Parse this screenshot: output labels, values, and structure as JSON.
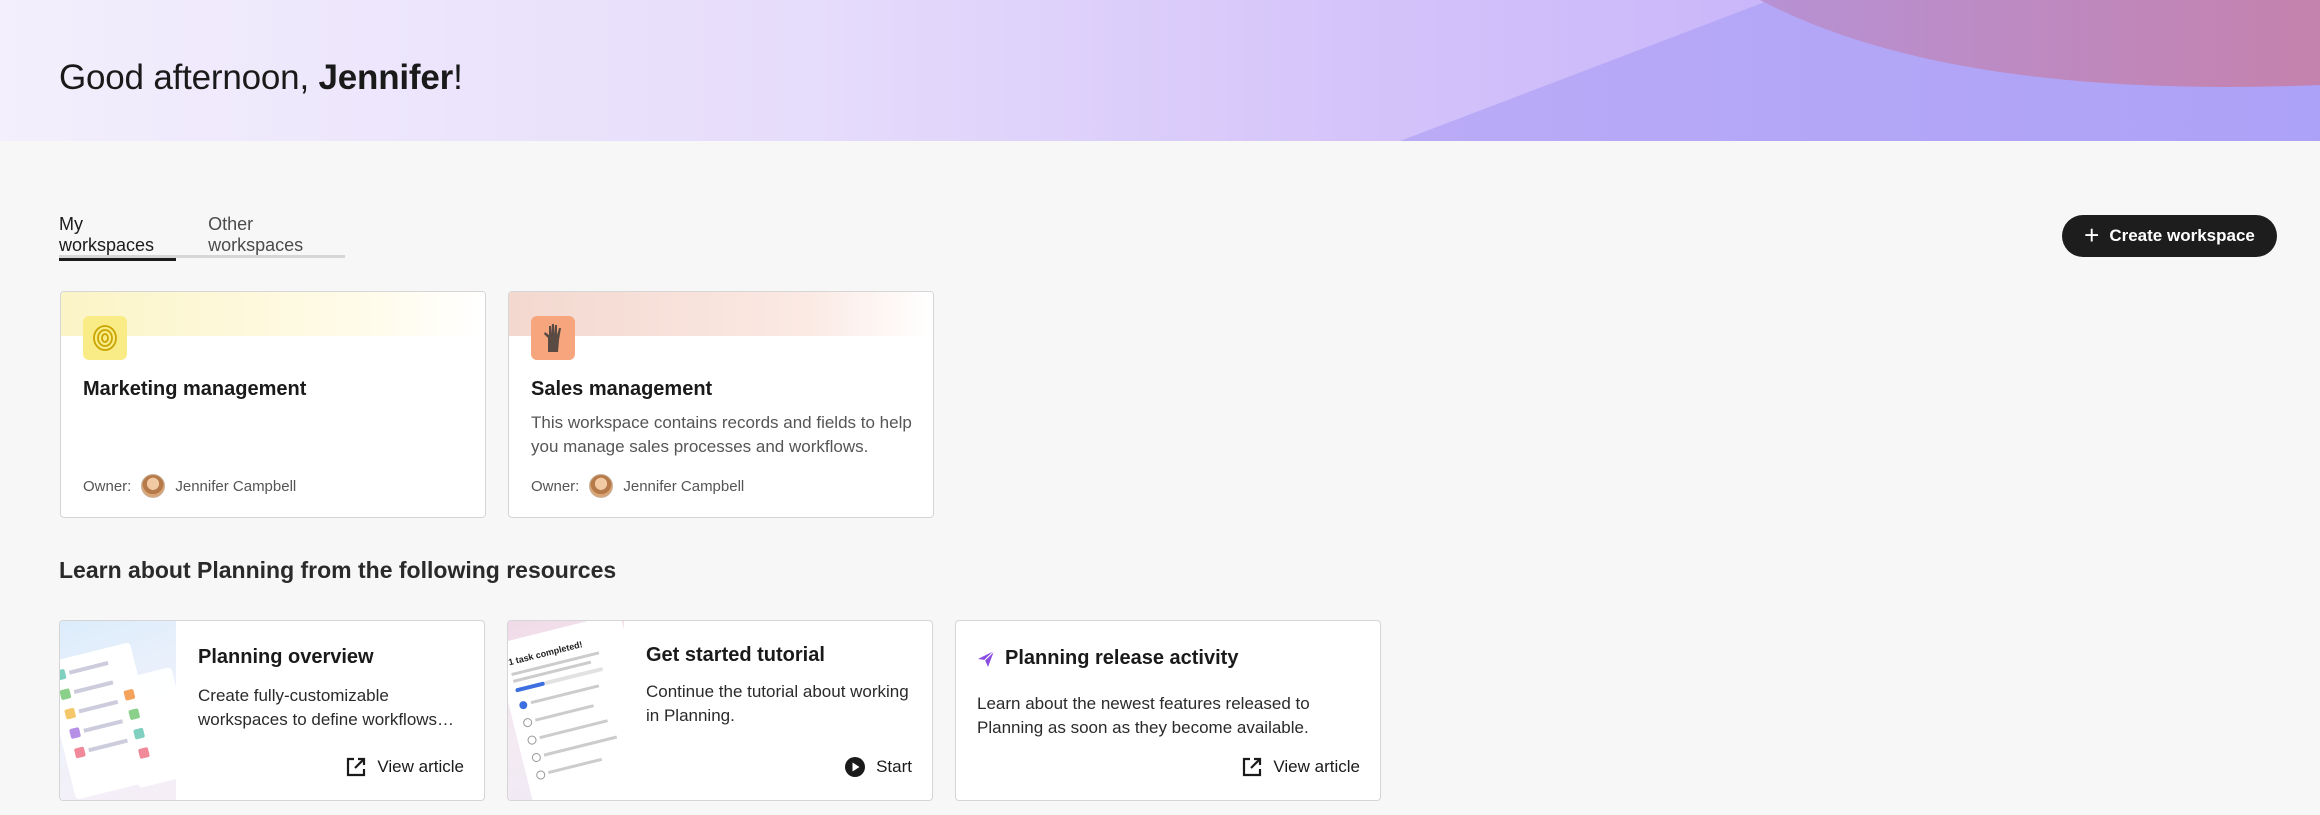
{
  "greeting": {
    "prefix": "Good afternoon, ",
    "name": "Jennifer",
    "suffix": "!"
  },
  "tabs": [
    {
      "label": "My workspaces",
      "active": true
    },
    {
      "label": "Other workspaces",
      "active": false
    }
  ],
  "create_button": {
    "label": "Create workspace"
  },
  "workspaces": [
    {
      "title": "Marketing management",
      "description": "",
      "owner_label": "Owner:",
      "owner_name": "Jennifer Campbell",
      "icon": "fingerprint-icon",
      "accent": "#fbf3bd"
    },
    {
      "title": "Sales management",
      "description": "This workspace contains records and fields to help you manage sales processes and workflows.",
      "owner_label": "Owner:",
      "owner_name": "Jennifer Campbell",
      "icon": "raised-hand-icon",
      "accent": "#f8d9cf"
    }
  ],
  "resources": {
    "title": "Learn about Planning from the following resources",
    "items": [
      {
        "title": "Planning overview",
        "description": "Create fully-customizable workspaces to define workflows…",
        "action": "View article",
        "action_icon": "external-link-icon"
      },
      {
        "title": "Get started tutorial",
        "description": "Continue the tutorial about working in Planning.",
        "action": "Start",
        "action_icon": "play-icon",
        "thumb_text": "1 task completed!"
      },
      {
        "title": "Planning release activity",
        "description": "Learn about the newest features released to Planning as soon as they become available.",
        "action": "View article",
        "action_icon": "external-link-icon",
        "title_icon": "paper-plane-icon"
      }
    ]
  },
  "colors": {
    "primary_button": "#1d1d1d",
    "background": "#f7f7f7",
    "hero_start": "#f3effc",
    "hero_end": "#bfa9f9"
  }
}
